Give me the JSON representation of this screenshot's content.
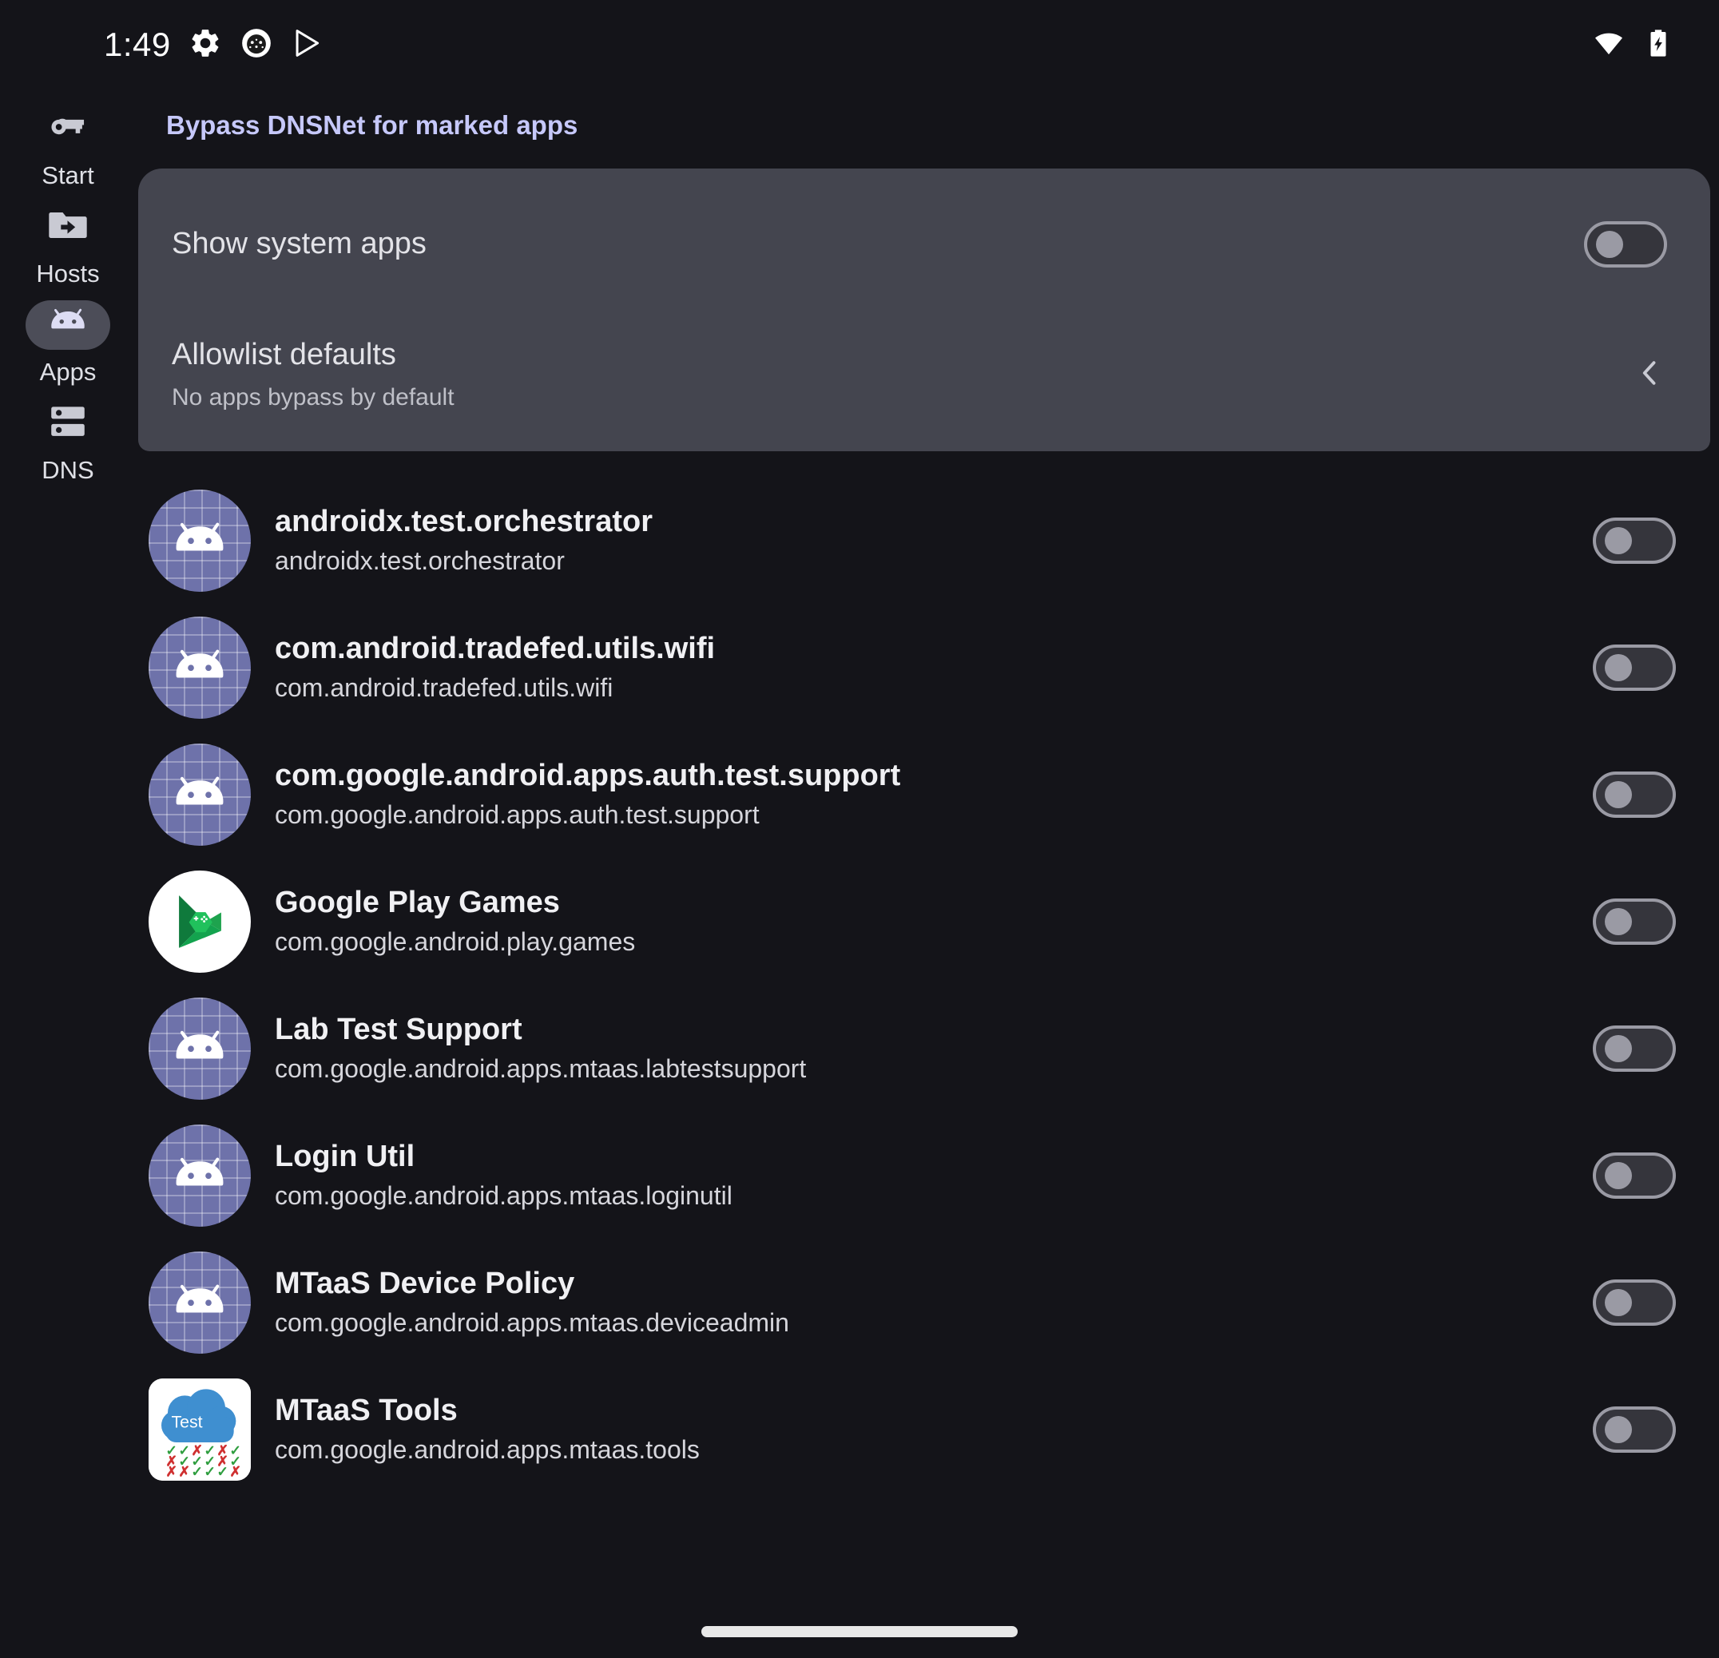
{
  "status_bar": {
    "time": "1:49",
    "left_icons": [
      "gear-icon",
      "app-badge-icon",
      "play-store-icon"
    ],
    "right_icons": [
      "wifi-icon",
      "battery-charging-icon"
    ]
  },
  "sidebar": {
    "items": [
      {
        "label": "Start",
        "icon": "key-icon",
        "active": false
      },
      {
        "label": "Hosts",
        "icon": "folder-arrow-icon",
        "active": false
      },
      {
        "label": "Apps",
        "icon": "android-head-icon",
        "active": true
      },
      {
        "label": "DNS",
        "icon": "server-icon",
        "active": false
      }
    ]
  },
  "main": {
    "section_title": "Bypass DNSNet for marked apps",
    "settings_card": {
      "show_system_apps": {
        "title": "Show system apps",
        "toggle_state": "off"
      },
      "allowlist_defaults": {
        "title": "Allowlist defaults",
        "subtitle": "No apps bypass by default",
        "chevron": "chevron-left-icon"
      }
    },
    "apps": [
      {
        "name": "androidx.test.orchestrator",
        "package": "androidx.test.orchestrator",
        "icon": "android-grid-icon",
        "toggle_state": "off"
      },
      {
        "name": "com.android.tradefed.utils.wifi",
        "package": "com.android.tradefed.utils.wifi",
        "icon": "android-grid-icon",
        "toggle_state": "off"
      },
      {
        "name": "com.google.android.apps.auth.test.support",
        "package": "com.google.android.apps.auth.test.support",
        "icon": "android-grid-icon",
        "toggle_state": "off"
      },
      {
        "name": "Google Play Games",
        "package": "com.google.android.play.games",
        "icon": "play-games-icon",
        "toggle_state": "off"
      },
      {
        "name": "Lab Test Support",
        "package": "com.google.android.apps.mtaas.labtestsupport",
        "icon": "android-grid-icon",
        "toggle_state": "off"
      },
      {
        "name": "Login Util",
        "package": "com.google.android.apps.mtaas.loginutil",
        "icon": "android-grid-icon",
        "toggle_state": "off"
      },
      {
        "name": "MTaaS Device Policy",
        "package": "com.google.android.apps.mtaas.deviceadmin",
        "icon": "android-grid-icon",
        "toggle_state": "off"
      },
      {
        "name": "MTaaS Tools",
        "package": "com.google.android.apps.mtaas.tools",
        "icon": "mtaas-tools-icon",
        "toggle_state": "off"
      }
    ]
  },
  "colors": {
    "background": "#141419",
    "card": "#44454f",
    "accent_title": "#c6c8fa",
    "icon_purple": "#6e72aa",
    "nav_active_pill": "#4c4d58"
  }
}
